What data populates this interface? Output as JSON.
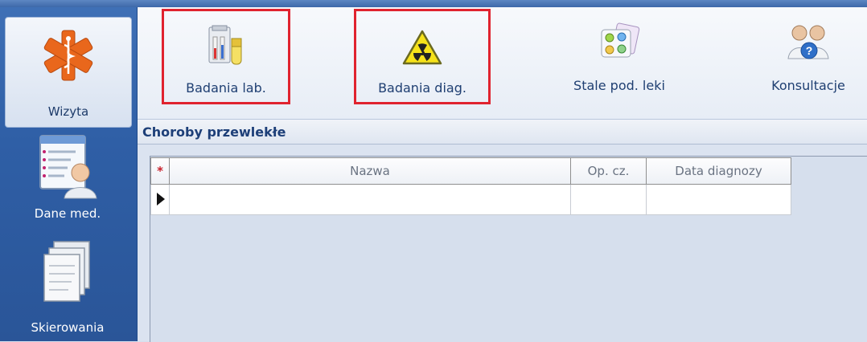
{
  "sidebar": {
    "items": [
      {
        "label": "Wizyta",
        "icon": "medical-star-icon",
        "active": true
      },
      {
        "label": "Dane med.",
        "icon": "patient-record-icon",
        "active": false
      },
      {
        "label": "Skierowania",
        "icon": "documents-icon",
        "active": false
      }
    ]
  },
  "toolbar": {
    "buttons": [
      {
        "label": "Badania lab.",
        "icon": "lab-flasks-icon",
        "highlighted": true
      },
      {
        "label": "Badania diag.",
        "icon": "radiation-warning-icon",
        "highlighted": true
      },
      {
        "label": "Stale pod. leki",
        "icon": "pills-palette-icon",
        "highlighted": false
      },
      {
        "label": "Konsultacje",
        "icon": "doctors-consult-icon",
        "highlighted": false
      }
    ]
  },
  "section": {
    "title": "Choroby przewlekłe",
    "table": {
      "new_row_marker": "*",
      "columns": [
        "Nazwa",
        "Op. cz.",
        "Data diagnozy"
      ],
      "rows": [
        [
          "",
          "",
          ""
        ]
      ]
    }
  },
  "colors": {
    "sidebar_blue": "#2f5fa6",
    "highlight_red": "#e0232f",
    "header_text": "#1d3f78"
  }
}
